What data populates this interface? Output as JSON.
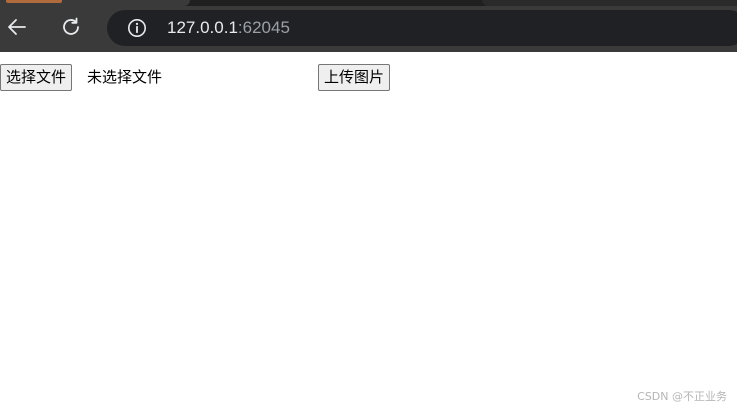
{
  "browser": {
    "url_host": "127.0.0.1",
    "url_port": ":62045"
  },
  "page": {
    "choose_file_label": "选择文件",
    "file_status": "未选择文件",
    "upload_label": "上传图片"
  },
  "watermark": "CSDN @不正业务",
  "icons": {
    "back": "arrow-left-icon",
    "reload": "reload-icon",
    "site_info": "info-icon"
  },
  "colors": {
    "chrome_bg": "#3a3a3a",
    "omnibox_bg": "#202124",
    "url_host": "#e8eaed",
    "url_port": "#9aa0a6",
    "button_bg": "#efefef",
    "button_border": "#767676"
  }
}
